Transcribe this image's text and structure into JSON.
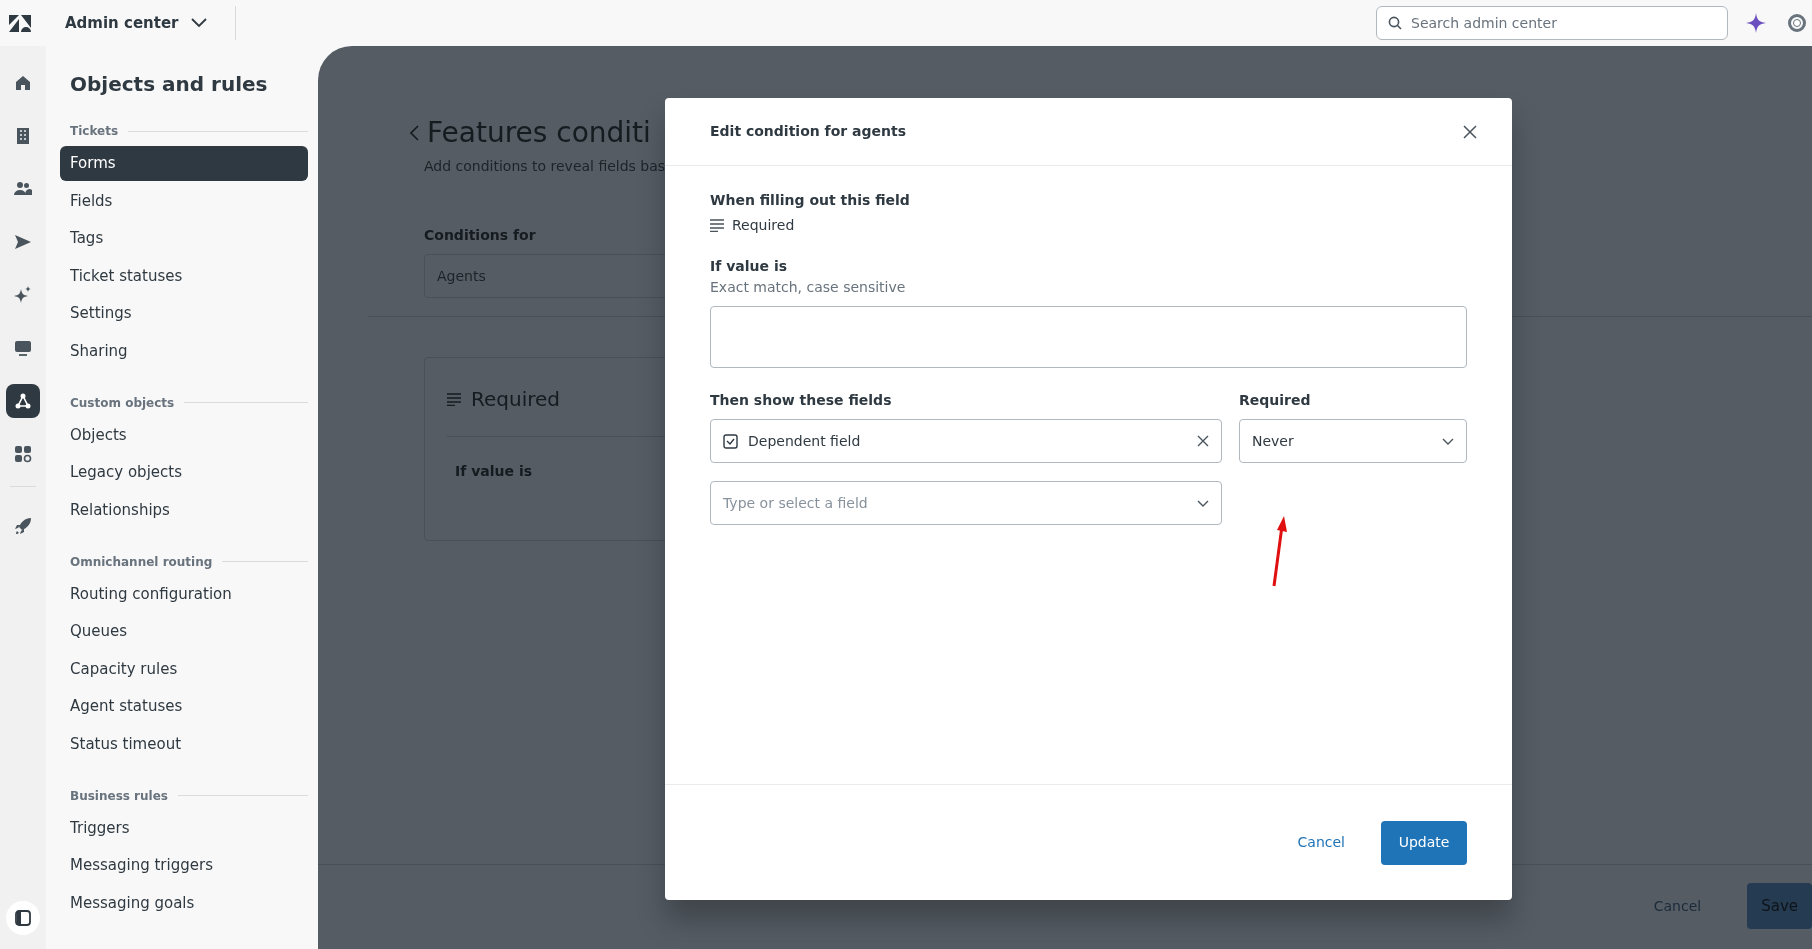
{
  "topbar": {
    "product": "Admin center",
    "search": {
      "placeholder": "Search admin center"
    }
  },
  "rail": {
    "items": [
      {
        "kind": "home",
        "selected": false
      },
      {
        "kind": "building",
        "selected": false
      },
      {
        "kind": "people",
        "selected": false
      },
      {
        "kind": "send",
        "selected": false
      },
      {
        "kind": "sparkle",
        "selected": false
      },
      {
        "kind": "monitor",
        "selected": false
      },
      {
        "kind": "objects",
        "selected": true
      },
      {
        "kind": "apps",
        "selected": false
      },
      {
        "kind": "rocket",
        "selected": false
      }
    ]
  },
  "sidebar": {
    "title": "Objects and rules",
    "sections": [
      {
        "heading": "Tickets",
        "items": [
          {
            "label": "Forms",
            "selected": true
          },
          {
            "label": "Fields",
            "selected": false
          },
          {
            "label": "Tags",
            "selected": false
          },
          {
            "label": "Ticket statuses",
            "selected": false
          },
          {
            "label": "Settings",
            "selected": false
          },
          {
            "label": "Sharing",
            "selected": false
          }
        ]
      },
      {
        "heading": "Custom objects",
        "items": [
          {
            "label": "Objects",
            "selected": false
          },
          {
            "label": "Legacy objects",
            "selected": false
          },
          {
            "label": "Relationships",
            "selected": false
          }
        ]
      },
      {
        "heading": "Omnichannel routing",
        "items": [
          {
            "label": "Routing configuration",
            "selected": false
          },
          {
            "label": "Queues",
            "selected": false
          },
          {
            "label": "Capacity rules",
            "selected": false
          },
          {
            "label": "Agent statuses",
            "selected": false
          },
          {
            "label": "Status timeout",
            "selected": false
          }
        ]
      },
      {
        "heading": "Business rules",
        "items": [
          {
            "label": "Triggers",
            "selected": false
          },
          {
            "label": "Messaging triggers",
            "selected": false
          },
          {
            "label": "Messaging goals",
            "selected": false
          }
        ]
      }
    ]
  },
  "page": {
    "title": "Features conditi",
    "subtitle": "Add conditions to reveal fields bas",
    "conditions_label": "Conditions for",
    "conditions_value": "Agents",
    "card": {
      "title": "Required",
      "condition_label": "If value is"
    },
    "footer": {
      "cancel": "Cancel",
      "save": "Save"
    }
  },
  "modal": {
    "title": "Edit condition for agents",
    "field_label": "When filling out this field",
    "field_name": "Required",
    "value_label": "If value is",
    "value_hint": "Exact match, case sensitive",
    "show_label": "Then show these fields",
    "required_label": "Required",
    "shown_fields": [
      {
        "name": "Dependent field",
        "required": "Never"
      }
    ],
    "add_placeholder": "Type or select a field",
    "cancel": "Cancel",
    "update": "Update"
  }
}
